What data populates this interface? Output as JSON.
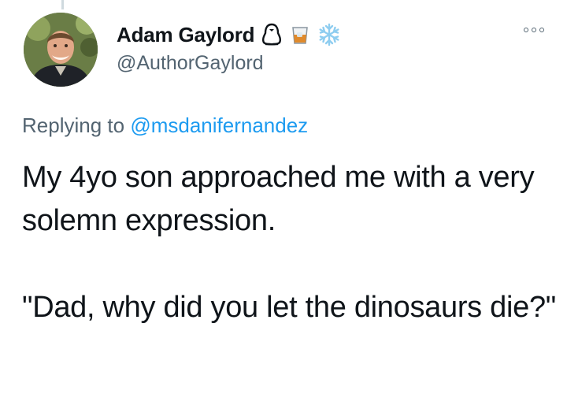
{
  "author": {
    "display_name": "Adam Gaylord",
    "handle": "@AuthorGaylord",
    "name_emojis": [
      "penguin-emoji",
      "tumbler-glass-emoji",
      "snowflake-emoji"
    ]
  },
  "reply": {
    "prefix": "Replying to",
    "mention": "@msdanifernandez"
  },
  "tweet": {
    "paragraphs": [
      "My 4yo son approached me with a very solemn expression.",
      "\"Dad, why did you let the dinosaurs die?\""
    ]
  },
  "icons": {
    "more": "more-options-icon"
  },
  "colors": {
    "text": "#0f1419",
    "secondary_text": "#536471",
    "link": "#1d9bf0"
  }
}
